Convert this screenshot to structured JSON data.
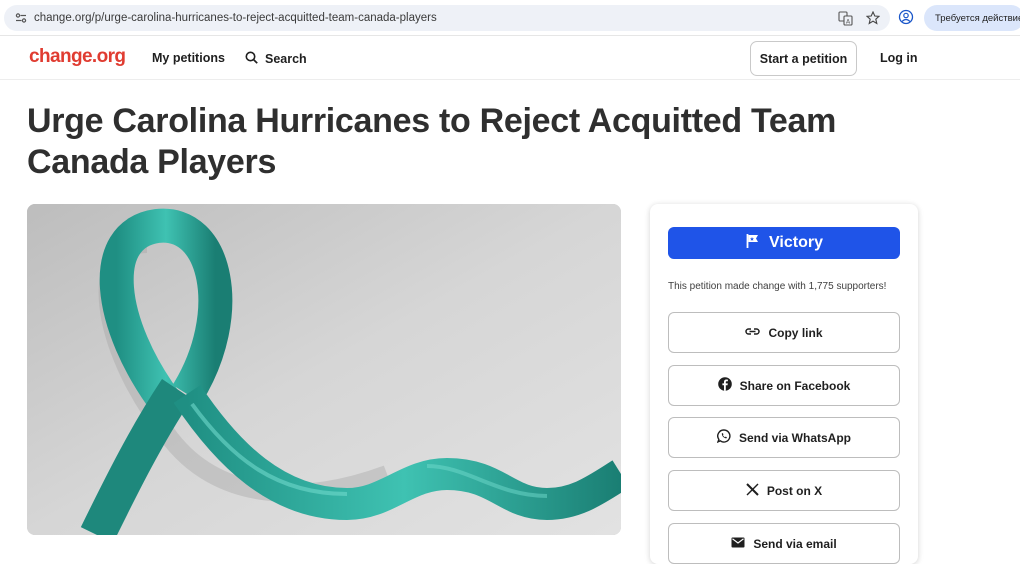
{
  "browser": {
    "url": "change.org/p/urge-carolina-hurricanes-to-reject-acquitted-team-canada-players",
    "action_chip": "Требуется действие"
  },
  "nav": {
    "logo": "change.org",
    "my_petitions": "My petitions",
    "search": "Search",
    "start_petition": "Start a petition",
    "login": "Log in"
  },
  "petition": {
    "title": "Urge Carolina Hurricanes to Reject Acquitted Team Canada Players"
  },
  "card": {
    "status": "Victory",
    "summary": "This petition made change with 1,775 supporters!",
    "actions": [
      {
        "label": "Copy link",
        "icon": "link-icon"
      },
      {
        "label": "Share on Facebook",
        "icon": "facebook-icon"
      },
      {
        "label": "Send via WhatsApp",
        "icon": "whatsapp-icon"
      },
      {
        "label": "Post on X",
        "icon": "x-icon"
      },
      {
        "label": "Send via email",
        "icon": "email-icon"
      }
    ]
  },
  "colors": {
    "brand": "#e03c31",
    "victory": "#1f54e8",
    "ribbon": "#2aa89a"
  }
}
